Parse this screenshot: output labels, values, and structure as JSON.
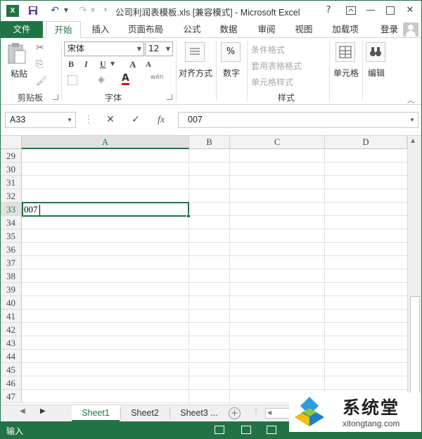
{
  "titlebar": {
    "title": "公司利润表模板.xls  [兼容模式] - Microsoft Excel",
    "app_icon_text": "X",
    "help": "?",
    "minimize": "—",
    "close": "✕"
  },
  "tabs": {
    "file": "文件",
    "items": [
      "开始",
      "插入",
      "页面布局",
      "公式",
      "数据",
      "审阅",
      "视图",
      "加载项"
    ],
    "active": "开始",
    "login": "登录"
  },
  "ribbon": {
    "clipboard": {
      "paste": "粘贴",
      "label": "剪贴板"
    },
    "font": {
      "name": "宋体",
      "size": "12",
      "bold": "B",
      "italic": "I",
      "underline": "U",
      "grow": "A",
      "shrink": "A",
      "font_color": "A",
      "phonetic": "wén",
      "label": "字体"
    },
    "alignment": {
      "label": "对齐方式"
    },
    "number": {
      "symbol": "%",
      "label": "数字"
    },
    "styles": {
      "conditional": "条件格式",
      "table": "套用表格格式",
      "cell_styles": "单元格样式",
      "label": "样式"
    },
    "cells": {
      "label": "单元格"
    },
    "editing": {
      "label": "编辑"
    }
  },
  "formula_bar": {
    "name_box": "A33",
    "cancel": "✕",
    "enter": "✓",
    "fx": "fx",
    "value": "007"
  },
  "grid": {
    "columns": [
      "A",
      "B",
      "C",
      "D"
    ],
    "selected_column": "A",
    "rows": [
      "29",
      "30",
      "31",
      "32",
      "33",
      "34",
      "35",
      "36",
      "37",
      "38",
      "39",
      "40",
      "41",
      "42",
      "43",
      "44",
      "45",
      "46",
      "47"
    ],
    "selected_row": "33",
    "active_cell_value": "007"
  },
  "sheets": {
    "tabs": [
      "Sheet1",
      "Sheet2",
      "Sheet3 ..."
    ],
    "active": "Sheet1",
    "add": "+"
  },
  "status": {
    "mode": "输入"
  },
  "watermark": {
    "cn": "系统堂",
    "en": "xitongtang.com"
  },
  "colors": {
    "accent": "#217346"
  }
}
